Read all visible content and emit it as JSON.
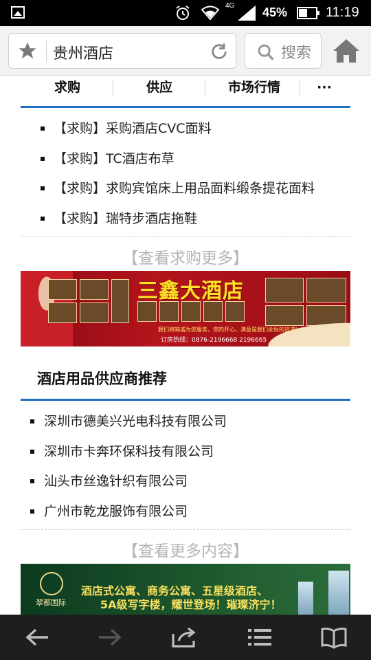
{
  "status_bar": {
    "network": "4G",
    "battery": "45%",
    "time": "11:19"
  },
  "browser": {
    "url": "贵州酒店",
    "search_label": "搜索"
  },
  "tabs": [
    {
      "label": "求购"
    },
    {
      "label": "供应"
    },
    {
      "label": "市场行情"
    },
    {
      "label": "···"
    }
  ],
  "purchase_list": [
    {
      "text": "【求购】采购酒店CVC面料"
    },
    {
      "text": "【求购】TC酒店布草"
    },
    {
      "text": "【求购】求购宾馆床上用品面料缎条提花面料"
    },
    {
      "text": "【求购】瑞特步酒店拖鞋"
    }
  ],
  "more_purchase": "【查看求购更多】",
  "banner1": {
    "title": "三鑫大酒店",
    "slogan": "我们将竭诚为您服务，您的开心，满意是我们永恒的追求！",
    "phone": "订房热线：0876-2196668  2196665"
  },
  "supplier_section_title": "酒店用品供应商推荐",
  "supplier_list": [
    {
      "text": "深圳市德美兴光电科技有限公司"
    },
    {
      "text": "深圳市卡奔环保科技有限公司"
    },
    {
      "text": "汕头市丝逸针织有限公司"
    },
    {
      "text": "广州市乾龙服饰有限公司"
    }
  ],
  "more_content": "【查看更多内容】",
  "banner2": {
    "logo_text": "翠都国际",
    "line1": "酒店式公寓、商务公寓、五星级酒店、",
    "line2": "5A级写字楼，耀世登场！璀璨济宁！"
  },
  "colors": {
    "accent_blue": "#1f6fc2",
    "muted_link": "#b5b5b5"
  }
}
